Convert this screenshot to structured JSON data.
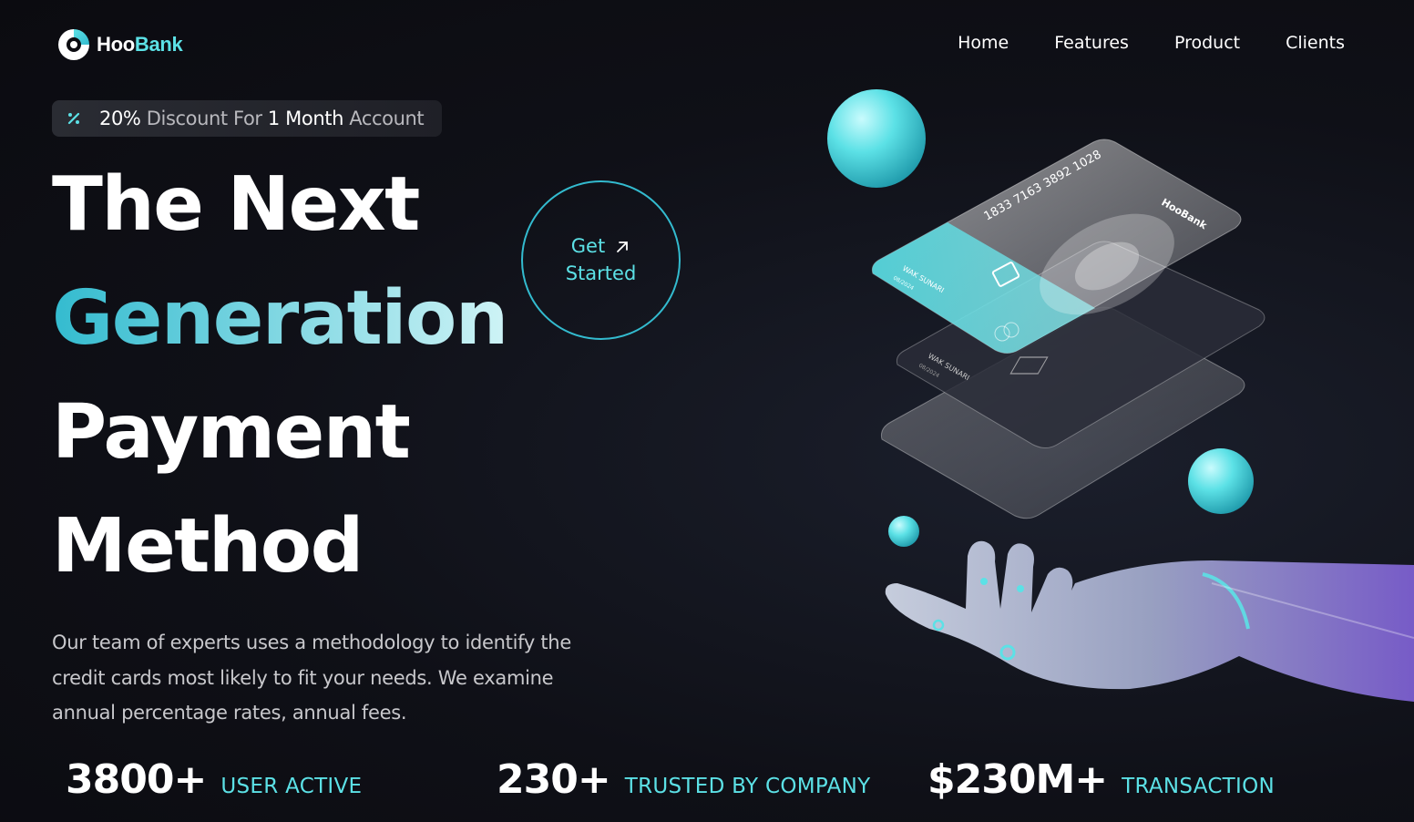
{
  "brand": {
    "name_part1": "Hoo",
    "name_part2": "Bank",
    "accent": "#5ce1e6"
  },
  "nav": {
    "items": [
      "Home",
      "Features",
      "Product",
      "Clients"
    ]
  },
  "discount": {
    "icon": "percent-icon",
    "pct": "20%",
    "mid1": " Discount For ",
    "num": "1 Month",
    "mid2": " Account"
  },
  "hero": {
    "line1": "The Next",
    "line2": "Generation",
    "line3": "Payment",
    "line4": "Method",
    "cta_line1": "Get",
    "cta_line2": "Started",
    "description": "Our team of experts uses a methodology to identify the credit cards most likely to fit your needs. We examine annual percentage rates, annual fees."
  },
  "cards": {
    "number": "1833 7163 3892 1028",
    "holder": "WAK SUNARI",
    "expiry": "08/2024",
    "brand": "HooBank"
  },
  "stats": [
    {
      "value": "3800+",
      "label": "USER ACTIVE"
    },
    {
      "value": "230+",
      "label": "TRUSTED BY COMPANY"
    },
    {
      "value": "$230M+",
      "label": "TRANSACTION"
    }
  ]
}
